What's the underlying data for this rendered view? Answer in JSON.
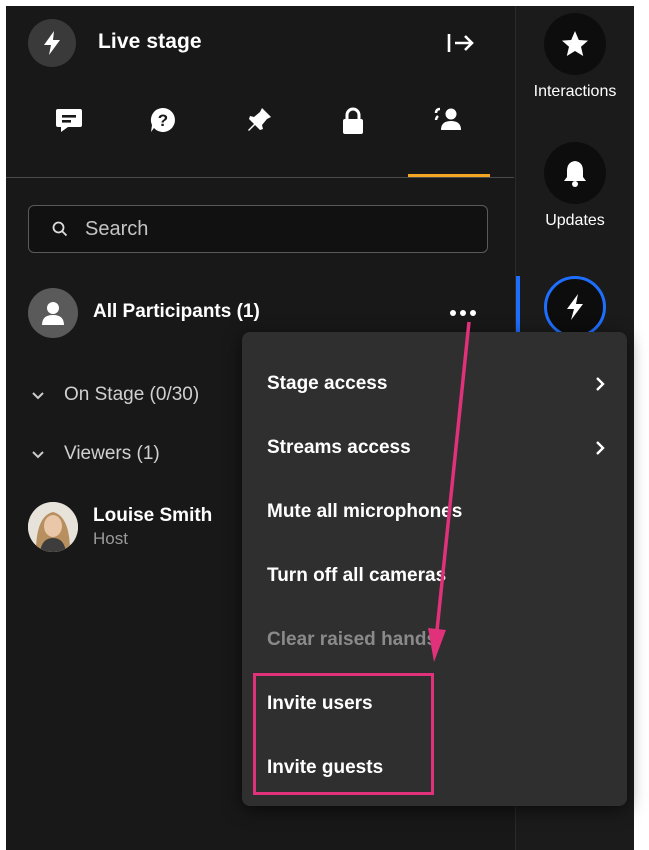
{
  "panel": {
    "title": "Live stage",
    "header_icon": "lightning-icon",
    "exit_icon": "exit-icon",
    "tabs": [
      {
        "icon": "chat-icon"
      },
      {
        "icon": "question-icon"
      },
      {
        "icon": "pin-icon"
      },
      {
        "icon": "lock-icon"
      },
      {
        "icon": "participants-icon",
        "active": true
      }
    ],
    "search": {
      "placeholder": "Search",
      "value": ""
    },
    "participants_label": "All Participants (1)",
    "sections": [
      {
        "label": "On Stage (0/30)"
      },
      {
        "label": "Viewers (1)"
      }
    ],
    "person": {
      "name": "Louise Smith",
      "role": "Host"
    }
  },
  "rail": {
    "items": [
      {
        "label": "Interactions",
        "icon": "star-icon"
      },
      {
        "label": "Updates",
        "icon": "bell-icon"
      },
      {
        "label": "",
        "icon": "lightning-icon",
        "active": true
      }
    ]
  },
  "menu": {
    "items": [
      {
        "label": "Stage access",
        "submenu": true
      },
      {
        "label": "Streams access",
        "submenu": true
      },
      {
        "label": "Mute all microphones"
      },
      {
        "label": "Turn off all cameras"
      },
      {
        "label": "Clear raised hands",
        "disabled": true
      },
      {
        "label": "Invite users"
      },
      {
        "label": "Invite guests"
      }
    ]
  },
  "colors": {
    "background": "#181818",
    "menu": "#2f2f2f",
    "tab_accent": "#f5a524",
    "rail_active": "#1e6fff",
    "annotation": "#e0317a"
  }
}
